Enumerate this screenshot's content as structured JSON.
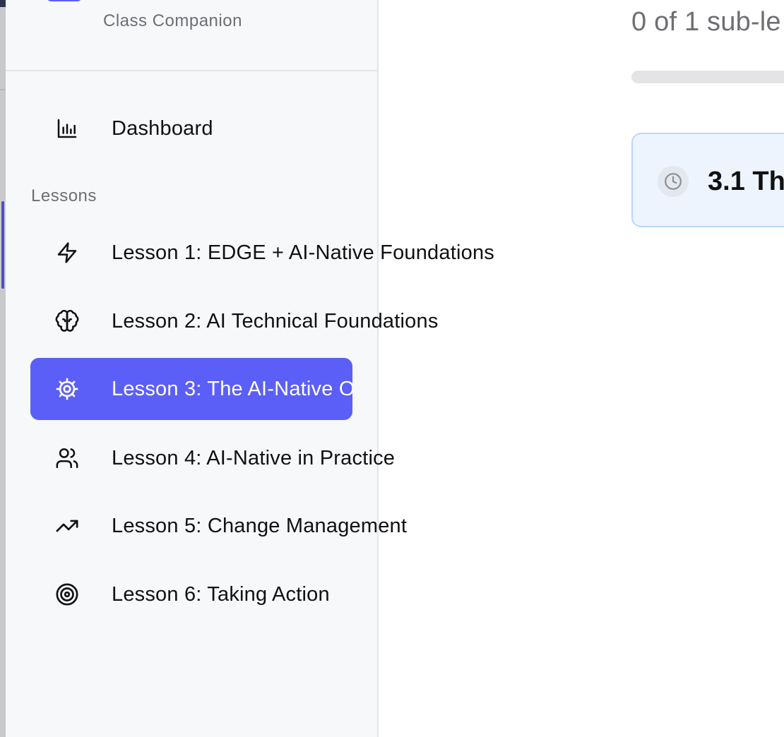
{
  "app": {
    "subtitle": "Class Companion"
  },
  "sidebar": {
    "dashboard": {
      "label": "Dashboard",
      "icon": "bar-chart-icon"
    },
    "lessons_heading": "Lessons",
    "lessons": [
      {
        "label": "Lesson 1: EDGE + AI-Native Foundations",
        "icon": "lightning-icon",
        "active": false
      },
      {
        "label": "Lesson 2: AI Technical Foundations",
        "icon": "brain-icon",
        "active": false
      },
      {
        "label": "Lesson 3: The AI-Native O",
        "icon": "gear-icon",
        "active": true
      },
      {
        "label": "Lesson 4: AI-Native in Practice",
        "icon": "users-icon",
        "active": false
      },
      {
        "label": "Lesson 5: Change Management",
        "icon": "trending-up-icon",
        "active": false
      },
      {
        "label": "Lesson 6: Taking Action",
        "icon": "target-icon",
        "active": false
      }
    ]
  },
  "main": {
    "progress_text": "0 of 1 sub-le",
    "progress_fraction": 0,
    "sublesson": {
      "title": "3.1 Th",
      "icon": "clock-icon"
    }
  },
  "colors": {
    "accent": "#5b5ff7",
    "sidebar_bg": "#f7f8fa",
    "card_bg": "#edf4fe",
    "card_border": "#b9d6fb",
    "muted_text": "#6e6e73"
  }
}
